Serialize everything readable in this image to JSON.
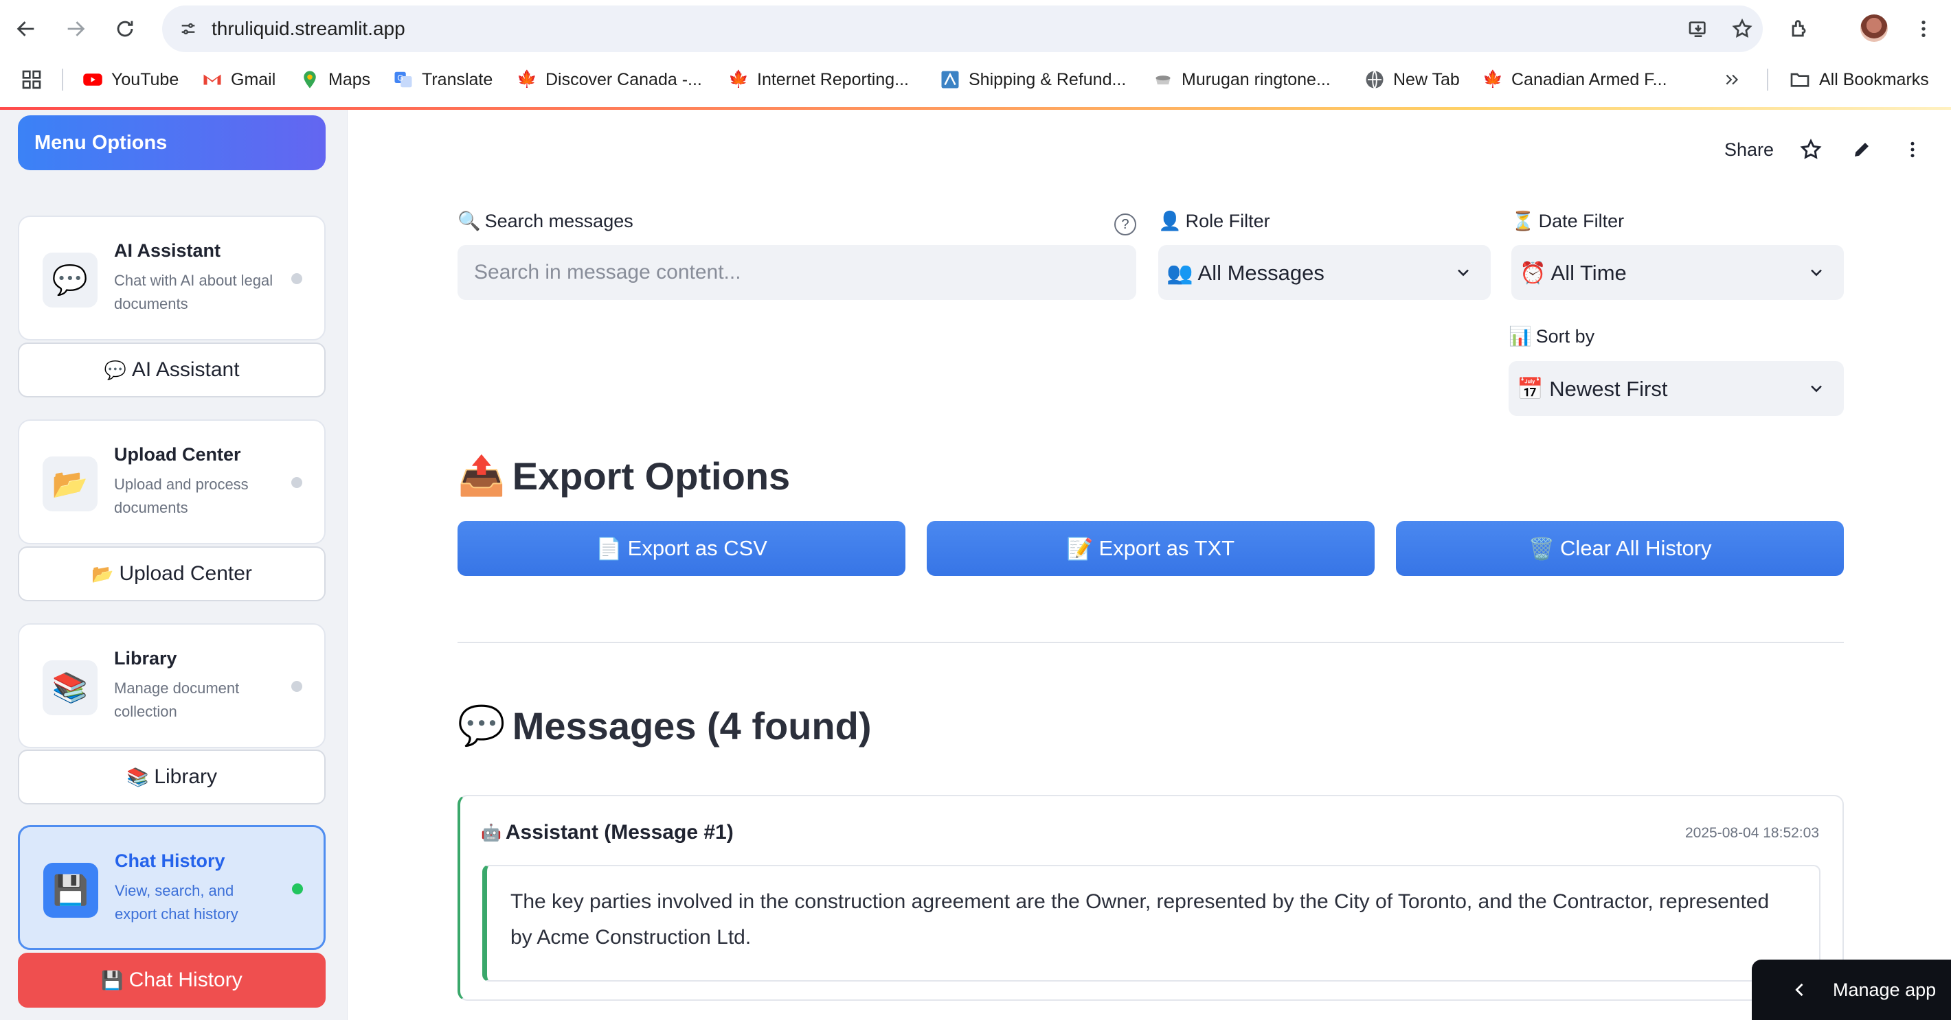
{
  "browser": {
    "url": "thruliquid.streamlit.app",
    "bookmarks": [
      {
        "label": "YouTube",
        "icon": "youtube-icon"
      },
      {
        "label": "Gmail",
        "icon": "gmail-icon"
      },
      {
        "label": "Maps",
        "icon": "maps-icon"
      },
      {
        "label": "Translate",
        "icon": "translate-icon"
      },
      {
        "label": "Discover Canada -...",
        "icon": "maple-leaf-icon"
      },
      {
        "label": "Internet Reporting...",
        "icon": "maple-leaf-icon"
      },
      {
        "label": "Shipping & Refund...",
        "icon": "shipping-icon"
      },
      {
        "label": "Murugan ringtone...",
        "icon": "ringtone-icon"
      },
      {
        "label": "New Tab",
        "icon": "globe-icon"
      },
      {
        "label": "Canadian Armed F...",
        "icon": "maple-leaf-icon"
      }
    ],
    "all_bookmarks": "All Bookmarks"
  },
  "sidebar": {
    "menu_title": "Menu Options",
    "items": [
      {
        "title": "AI Assistant",
        "desc": "Chat with AI about legal documents",
        "icon": "💬",
        "button": "AI Assistant"
      },
      {
        "title": "Upload Center",
        "desc": "Upload and process documents",
        "icon": "📂",
        "button": "Upload Center"
      },
      {
        "title": "Library",
        "desc": "Manage document collection",
        "icon": "📚",
        "button": "Library"
      },
      {
        "title": "Chat History",
        "desc": "View, search, and export chat history",
        "icon": "💾",
        "button": "Chat History",
        "active": true
      }
    ]
  },
  "header": {
    "share": "Share"
  },
  "filters": {
    "search_label": "Search messages",
    "search_placeholder": "Search in message content...",
    "role_label": "Role Filter",
    "role_value": "All Messages",
    "date_label": "Date Filter",
    "date_value": "All Time",
    "sort_label": "Sort by",
    "sort_value": "Newest First"
  },
  "export": {
    "title": "Export Options",
    "csv": "Export as CSV",
    "txt": "Export as TXT",
    "clear": "Clear All History"
  },
  "messages": {
    "title": "Messages (4 found)",
    "items": [
      {
        "role": "Assistant (Message #1)",
        "timestamp": "2025-08-04 18:52:03",
        "text": "The key parties involved in the construction agreement are the Owner, represented by the City of Toronto, and the Contractor, represented by Acme Construction Ltd."
      }
    ]
  },
  "manage_app": "Manage app",
  "colors": {
    "accent_blue": "#3b82f6",
    "active_red": "#ef4f4f",
    "message_green": "#3aa86b"
  }
}
